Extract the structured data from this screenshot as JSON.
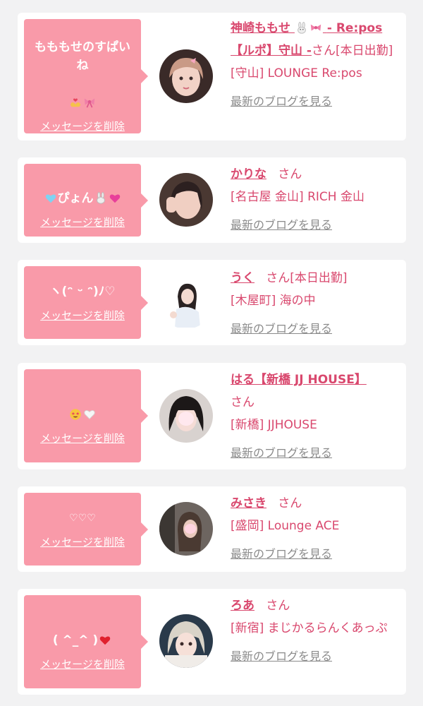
{
  "colors": {
    "page_bg": "#f2f2f3",
    "card_bg": "#ffffff",
    "bubble_bg": "#f99aa9",
    "accent_text": "#d9486e",
    "muted_link": "#8b8b8b"
  },
  "labels": {
    "delete_message": "メッセージを削除",
    "view_blog": "最新のブログを見る",
    "honorific": "さん"
  },
  "items": [
    {
      "message": "もももせのすぱいね",
      "message_icons": [
        "hands-heart-icon",
        "pink-ribbon-icon"
      ],
      "name": "神崎ももせ",
      "name_icons": [
        "bunny-icon",
        "pink-ribbon-icon"
      ],
      "name_suffix": "- Re:pos 【ルポ】守山 -",
      "status": "[本日出勤]",
      "shop": "[守山] LOUNGE Re:pos"
    },
    {
      "message_prefix_icon": "light-blue-heart-icon",
      "message": "ぴょん",
      "message_icons": [
        "bunny-icon",
        "pink-heart-icon"
      ],
      "name": "かりな",
      "name_icons": [],
      "name_suffix": "",
      "status": "",
      "shop": "[名古屋 金山] RICH 金山"
    },
    {
      "message": "ヽ(ᵔ ᵕ ᵔ)ﾉ♡",
      "message_icons": [],
      "name": "うく",
      "name_icons": [],
      "name_suffix": "",
      "status": "[本日出勤]",
      "shop": "[木屋町] 海の中"
    },
    {
      "message": "",
      "message_icons": [
        "star-eyes-icon",
        "white-heart-icon"
      ],
      "name": "はる【新橋 JJ HOUSE】",
      "name_icons": [],
      "name_suffix": "",
      "status": "",
      "shop": "[新橋] JJHOUSE"
    },
    {
      "message": "♡♡♡",
      "message_icons": [],
      "name": "みさき",
      "name_icons": [],
      "name_suffix": "",
      "status": "",
      "shop": "[盛岡] Lounge ACE"
    },
    {
      "message": "( ^_^ )",
      "message_icons": [
        "red-heart-icon"
      ],
      "name": "ろあ",
      "name_icons": [],
      "name_suffix": "",
      "status": "",
      "shop": "[新宿] まじかるらんくあっぷ"
    }
  ]
}
